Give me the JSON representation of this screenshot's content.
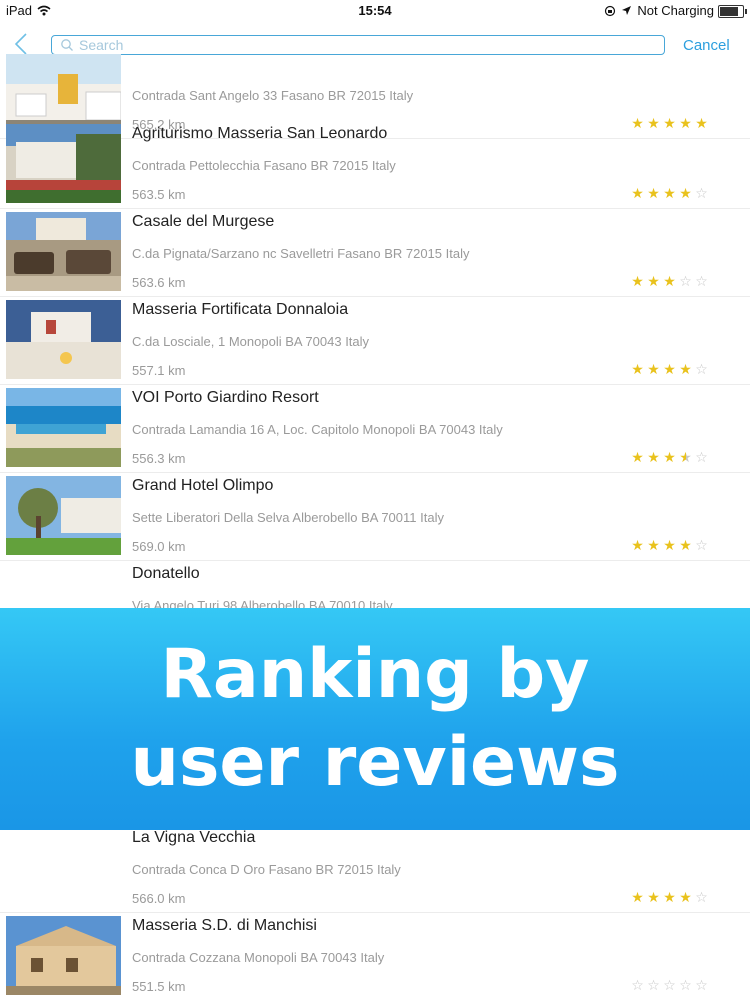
{
  "status_bar": {
    "device": "iPad",
    "time": "15:54",
    "battery": "Not Charging"
  },
  "nav": {
    "search_placeholder": "Search",
    "cancel_label": "Cancel"
  },
  "colors": {
    "accent": "#2d9fde",
    "star": "#e9c21d",
    "banner": "#1fa2ec"
  },
  "hotels": [
    {
      "name": "",
      "address": "Contrada Sant Angelo 33 Fasano BR 72015 Italy",
      "distance": "565.2 km",
      "rating": 5
    },
    {
      "name": "Agriturismo Masseria San Leonardo",
      "address": "Contrada Pettolecchia Fasano BR 72015 Italy",
      "distance": "563.5 km",
      "rating": 4
    },
    {
      "name": "Casale del Murgese",
      "address": "C.da Pignata/Sarzano nc Savelletri Fasano BR 72015 Italy",
      "distance": "563.6 km",
      "rating": 3
    },
    {
      "name": "Masseria Fortificata Donnaloia",
      "address": "C.da Losciale, 1 Monopoli BA 70043 Italy",
      "distance": "557.1 km",
      "rating": 4
    },
    {
      "name": "VOI Porto Giardino Resort",
      "address": "Contrada Lamandia 16 A, Loc. Capitolo Monopoli BA 70043 Italy",
      "distance": "556.3 km",
      "rating": 3.5
    },
    {
      "name": "Grand Hotel Olimpo",
      "address": "Sette Liberatori Della Selva Alberobello BA 70011 Italy",
      "distance": "569.0 km",
      "rating": 4
    },
    {
      "name": "Donatello",
      "address": "Via Angelo Turi 98 Alberobello BA 70010 Italy",
      "distance": "",
      "rating": 0
    },
    {
      "name": "La Vigna Vecchia",
      "address": "Contrada Conca D Oro Fasano BR 72015 Italy",
      "distance": "566.0 km",
      "rating": 4
    },
    {
      "name": "Masseria S.D. di Manchisi",
      "address": "Contrada Cozzana Monopoli BA 70043 Italy",
      "distance": "551.5 km",
      "rating": 0
    }
  ],
  "banner": {
    "line1": "Ranking by",
    "line2": "user reviews"
  }
}
